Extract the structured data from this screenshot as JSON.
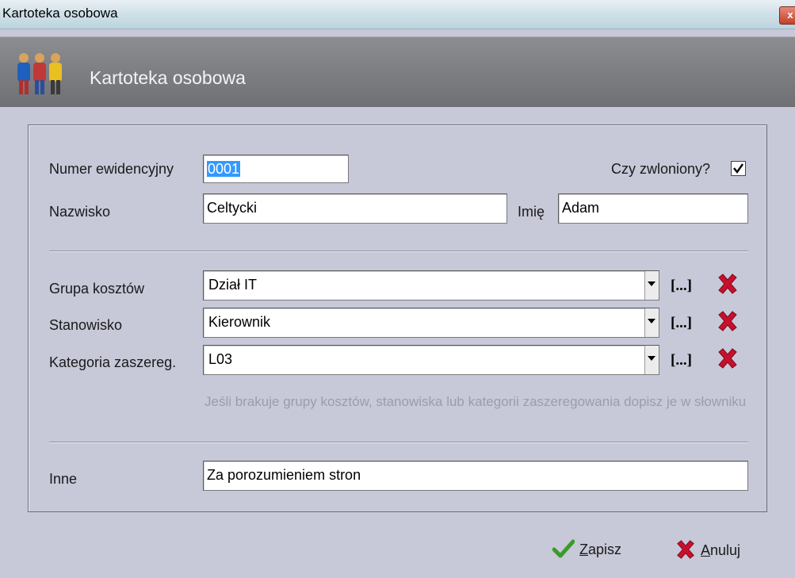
{
  "window": {
    "title": "Kartoteka osobowa",
    "close_glyph": "x"
  },
  "header": {
    "title": "Kartoteka osobowa",
    "icon": "people-icon"
  },
  "form": {
    "numer": {
      "label": "Numer ewidencyjny",
      "value": "0001"
    },
    "zwolniony": {
      "label": "Czy zwloniony?",
      "checked": true
    },
    "nazwisko": {
      "label": "Nazwisko",
      "value": "Celtycki"
    },
    "imie": {
      "label": "Imię",
      "value": "Adam"
    },
    "grupa": {
      "label": "Grupa kosztów",
      "value": "Dział IT"
    },
    "stanowisko": {
      "label": "Stanowisko",
      "value": "Kierownik"
    },
    "kategoria": {
      "label": "Kategoria zaszereg.",
      "value": "L03"
    },
    "dict_button_label": "[...]",
    "hint": "Jeśli brakuje grupy kosztów, stanowiska lub kategorii zaszeregowania dopisz je w słowniku",
    "inne": {
      "label": "Inne",
      "value": "Za porozumieniem stron"
    }
  },
  "footer": {
    "save": {
      "accel": "Z",
      "rest": "apisz",
      "icon": "check-icon"
    },
    "cancel": {
      "accel": "A",
      "rest": "nuluj",
      "icon": "cross-icon"
    }
  },
  "colors": {
    "header_bg": "#7a7b80",
    "window_bg": "#c7c8d8",
    "delete_red": "#c8102e",
    "save_green": "#3a9a2a"
  }
}
